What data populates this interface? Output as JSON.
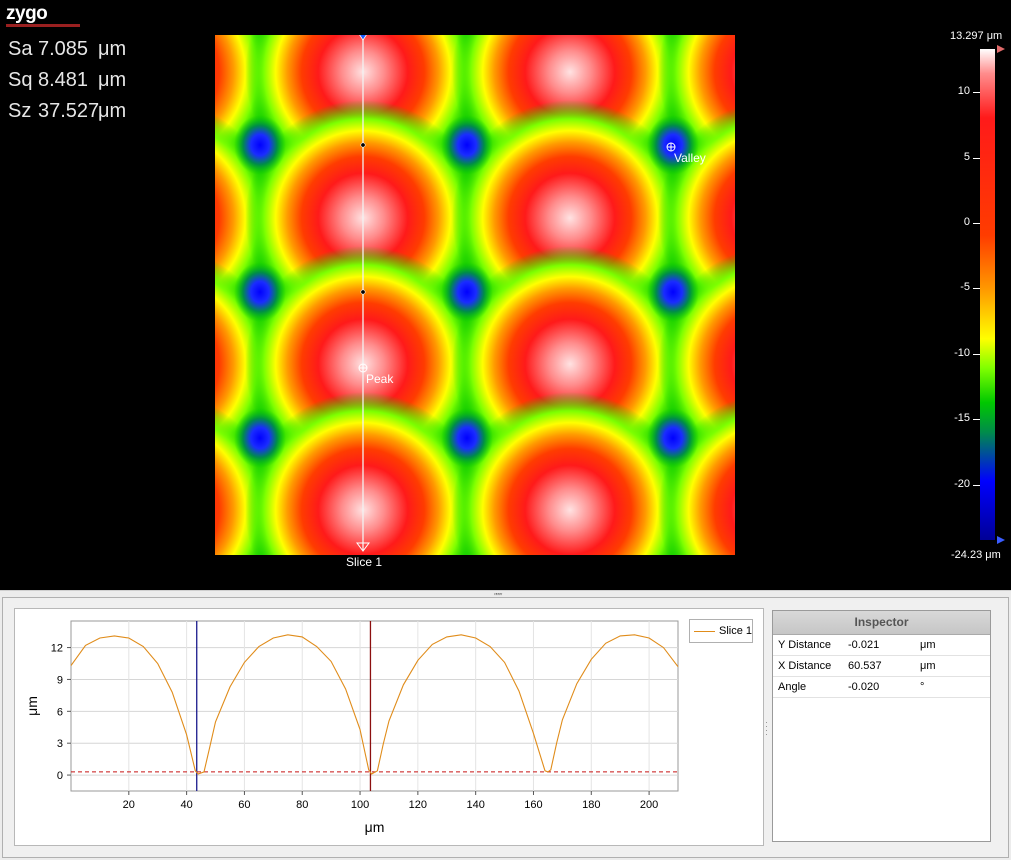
{
  "logo": {
    "text": "zygo"
  },
  "stats": [
    {
      "label": "Sa",
      "value": "7.085",
      "unit": "μm"
    },
    {
      "label": "Sq",
      "value": "8.481",
      "unit": "μm"
    },
    {
      "label": "Sz",
      "value": "37.527",
      "unit": "μm"
    }
  ],
  "surface_map": {
    "markers": {
      "valley": "Valley",
      "peak": "Peak"
    },
    "slice_label": "Slice 1"
  },
  "color_scale": {
    "max_label": "13.297 μm",
    "min_label": "-24.23 μm",
    "max": 13.297,
    "min": -24.23,
    "ticks": [
      "10",
      "5",
      "0",
      "-5",
      "-10",
      "-15",
      "-20"
    ]
  },
  "chart_data": {
    "type": "line",
    "title": "",
    "xlabel": "μm",
    "ylabel": "μm",
    "xlim": [
      0,
      210
    ],
    "ylim": [
      -1.5,
      14.5
    ],
    "x_ticks": [
      20,
      40,
      60,
      80,
      100,
      120,
      140,
      160,
      180,
      200
    ],
    "y_ticks": [
      0,
      3,
      6,
      9,
      12
    ],
    "series": [
      {
        "name": "Slice 1",
        "color": "#e08c1a",
        "x": [
          0,
          5,
          10,
          15,
          20,
          25,
          30,
          35,
          40,
          43,
          44,
          46,
          48,
          50,
          55,
          60,
          65,
          70,
          75,
          80,
          85,
          90,
          95,
          100,
          103,
          104,
          106,
          108,
          110,
          115,
          120,
          125,
          130,
          135,
          140,
          145,
          150,
          155,
          160,
          164,
          165,
          166,
          168,
          170,
          175,
          180,
          185,
          190,
          195,
          200,
          205,
          210
        ],
        "values": [
          10.3,
          12.2,
          12.9,
          13.1,
          12.9,
          12.1,
          10.5,
          7.8,
          3.8,
          0.4,
          0.1,
          0.3,
          2.6,
          5.0,
          8.3,
          10.6,
          12.1,
          12.9,
          13.2,
          13.0,
          12.1,
          10.7,
          8.1,
          4.3,
          0.5,
          0.1,
          0.4,
          2.9,
          5.1,
          8.5,
          10.8,
          12.3,
          13.0,
          13.2,
          12.9,
          12.1,
          10.6,
          7.9,
          3.9,
          0.4,
          0.3,
          0.5,
          3.0,
          5.2,
          8.6,
          10.9,
          12.4,
          13.1,
          13.2,
          12.9,
          12.0,
          10.2
        ]
      }
    ],
    "cursors_x": [
      43.5,
      103.6
    ],
    "reference_y": 0.3
  },
  "legend": {
    "label": "Slice 1"
  },
  "inspector": {
    "title": "Inspector",
    "rows": [
      {
        "name": "Y Distance",
        "value": "-0.021",
        "unit": "μm"
      },
      {
        "name": "X Distance",
        "value": "60.537",
        "unit": "μm"
      },
      {
        "name": "Angle",
        "value": "-0.020",
        "unit": "°"
      }
    ]
  }
}
